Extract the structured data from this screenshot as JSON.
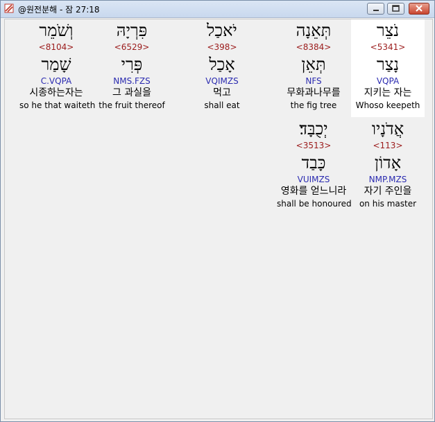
{
  "window": {
    "title": "@원전분해 - 잠 27:18"
  },
  "rows": [
    [
      {
        "hebrew": "נֹצֵר",
        "strong": "<5341>",
        "lemma": "נָצַר",
        "parse": "VQPA",
        "korean": "지키는 자는",
        "english": "Whoso keepeth"
      },
      {
        "hebrew": "תְּאֵנָה",
        "strong": "<8384>",
        "lemma": "תְּאֵן",
        "parse": "NFS",
        "korean": "무화과나무를",
        "english": "the fig tree"
      },
      {
        "hebrew": "יֹאכַל",
        "strong": "<398>",
        "lemma": "אָכַל",
        "parse": "VQIMZS",
        "korean": "먹고",
        "english": "shall eat"
      },
      {
        "hebrew": "פִּרְיָהּ",
        "strong": "<6529>",
        "lemma": "פְּרִי",
        "parse": "NMS.FZS",
        "korean": "그 과실을",
        "english": "the fruit thereof"
      },
      {
        "hebrew": "וְשֹׁמֵר",
        "strong": "<8104>",
        "lemma": "שָׁמַר",
        "parse": "C.VQPA",
        "korean": "시종하는자는",
        "english": "so he that waiteth"
      }
    ],
    [
      {
        "hebrew": "אֲדֹנָיו",
        "strong": "<113>",
        "lemma": "אָדוֹן",
        "parse": "NMP.MZS",
        "korean": "자기 주인을",
        "english": "on his master"
      },
      {
        "hebrew": "יְכֻבָּד׃",
        "strong": "<3513>",
        "lemma": "כָּבַד",
        "parse": "VUIMZS",
        "korean": "영화를 얻느니라",
        "english": "shall be honoured"
      }
    ]
  ]
}
